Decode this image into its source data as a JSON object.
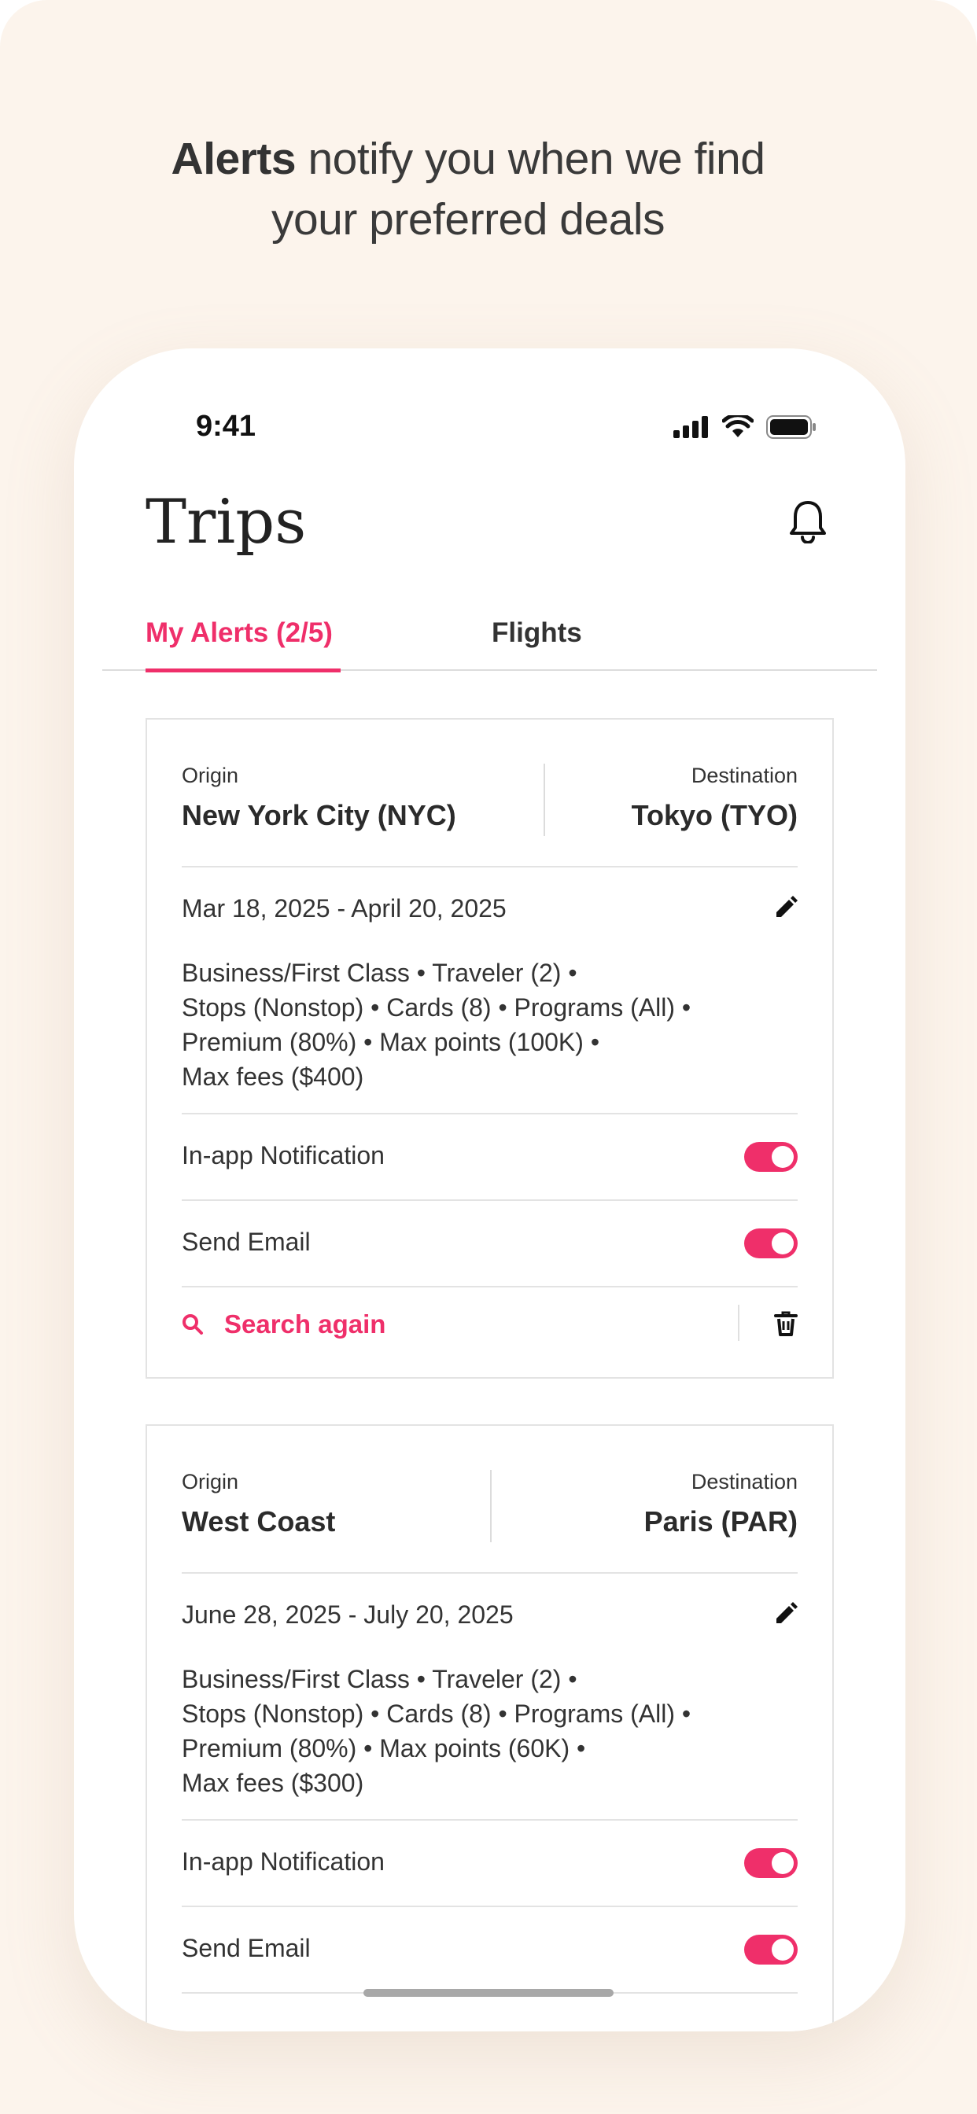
{
  "promo": {
    "headline_bold": "Alerts",
    "headline_rest_line1": " notify you when we find",
    "headline_line2": "your preferred deals"
  },
  "status_bar": {
    "time": "9:41"
  },
  "header": {
    "title": "Trips"
  },
  "tabs": [
    {
      "label": "My Alerts (2/5)",
      "active": true
    },
    {
      "label": "Flights",
      "active": false
    }
  ],
  "alerts": [
    {
      "origin_label": "Origin",
      "origin": "New York City (NYC)",
      "destination_label": "Destination",
      "destination": "Tokyo (TYO)",
      "dates": "Mar 18, 2025 - April 20, 2025",
      "details": [
        "Business/First Class  •  Traveler (2)   •",
        "Stops (Nonstop) • Cards (8)  •  Programs (All) •",
        "Premium (80%) • Max points (100K) •",
        "Max fees ($400)"
      ],
      "inapp_label": "In-app Notification",
      "inapp_on": true,
      "email_label": "Send Email",
      "email_on": true,
      "search_again": "Search again"
    },
    {
      "origin_label": "Origin",
      "origin": "West Coast",
      "destination_label": "Destination",
      "destination": "Paris (PAR)",
      "dates": "June 28, 2025 - July 20, 2025",
      "details": [
        "Business/First Class  •  Traveler (2)   •",
        "Stops (Nonstop) • Cards (8)  •  Programs (All) •",
        "Premium (80%) • Max points (60K) •",
        "Max fees ($300)"
      ],
      "inapp_label": "In-app Notification",
      "inapp_on": true,
      "email_label": "Send Email",
      "email_on": true
    }
  ],
  "colors": {
    "accent": "#ef2f6a",
    "background": "#fcf4ec"
  }
}
